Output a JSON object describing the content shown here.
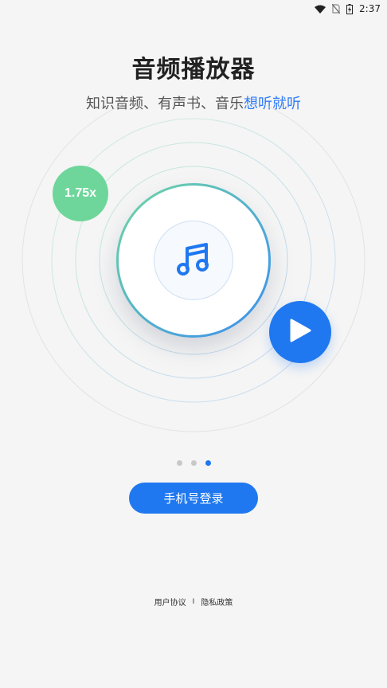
{
  "status_bar": {
    "time": "2:37"
  },
  "hero": {
    "title": "音频播放器",
    "subtitle_prefix": "知识音频、有声书、音乐",
    "subtitle_highlight": "想听就听"
  },
  "player": {
    "speed_label": "1.75x",
    "center_icon": "music-note-icon",
    "play_icon": "play-icon"
  },
  "pager": {
    "count": 3,
    "active_index": 2
  },
  "login_button": {
    "label": "手机号登录"
  },
  "footer": {
    "user_agreement": "用户协议",
    "separator": "I",
    "privacy_policy": "隐私政策"
  },
  "colors": {
    "accent": "#1f78f0",
    "highlight_text": "#2f7cf6",
    "speed_badge": "#6ed69a",
    "background": "#f5f5f5"
  }
}
